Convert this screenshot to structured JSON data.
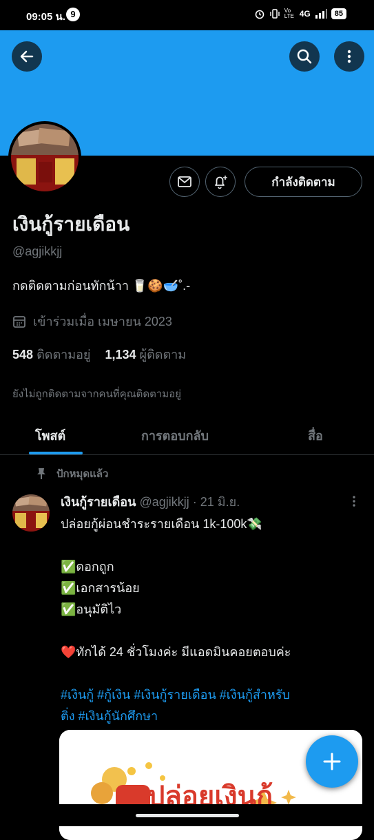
{
  "status_bar": {
    "time": "09:05 น.",
    "notification_count": "9",
    "network": "4G",
    "volte": "Vo LTE",
    "battery": "85"
  },
  "colors": {
    "accent": "#1d9bf0",
    "background": "#000000",
    "muted": "#71767b"
  },
  "profile": {
    "display_name": "เงินกู้รายเดือน",
    "handle": "@agjikkjj",
    "bio": "กดติดตามก่อนทักน้าา 🥛🍪🥣˚.-",
    "joined": "เข้าร่วมเมื่อ เมษายน 2023",
    "following_count": "548",
    "following_label": "ติดตามอยู่",
    "followers_count": "1,134",
    "followers_label": "ผู้ติดตาม",
    "not_followed_note": "ยังไม่ถูกติดตามจากคนที่คุณติดตามอยู่",
    "follow_button_label": "กำลังติดตาม"
  },
  "icons": {
    "back": "arrow-left-icon",
    "search": "search-icon",
    "more": "more-vertical-icon",
    "message": "envelope-icon",
    "notify": "bell-plus-icon",
    "calendar": "calendar-icon",
    "pin": "pin-icon",
    "compose": "plus-icon"
  },
  "tabs": [
    {
      "label": "โพสต์",
      "active": true
    },
    {
      "label": "การตอบกลับ",
      "active": false
    },
    {
      "label": "สื่อ",
      "active": false
    }
  ],
  "pinned_label": "ปักหมุดแล้ว",
  "tweet": {
    "author_name": "เงินกู้รายเดือน",
    "author_handle": "@agjikkjj",
    "separator": "·",
    "date": "21 มิ.ย.",
    "lines": [
      "ปล่อยกู้ผ่อนชำระรายเดือน 1k-100k💸",
      "",
      "✅ดอกถูก",
      "✅เอกสารน้อย",
      "✅อนุมัติไว",
      "",
      "❤️ทักได้ 24 ชั่วโมงค่ะ มีแอดมินคอยตอบค่ะ",
      ""
    ],
    "hashtags_line1": "#เงินกู้ #กู้เงิน #เงินกู้รายเดือน #เงินกู้สำหรับ",
    "hashtags_line2": "ติ่ง #เงินกู้นักศึกษา",
    "media_text": "ปล่อยเงินกู้"
  }
}
